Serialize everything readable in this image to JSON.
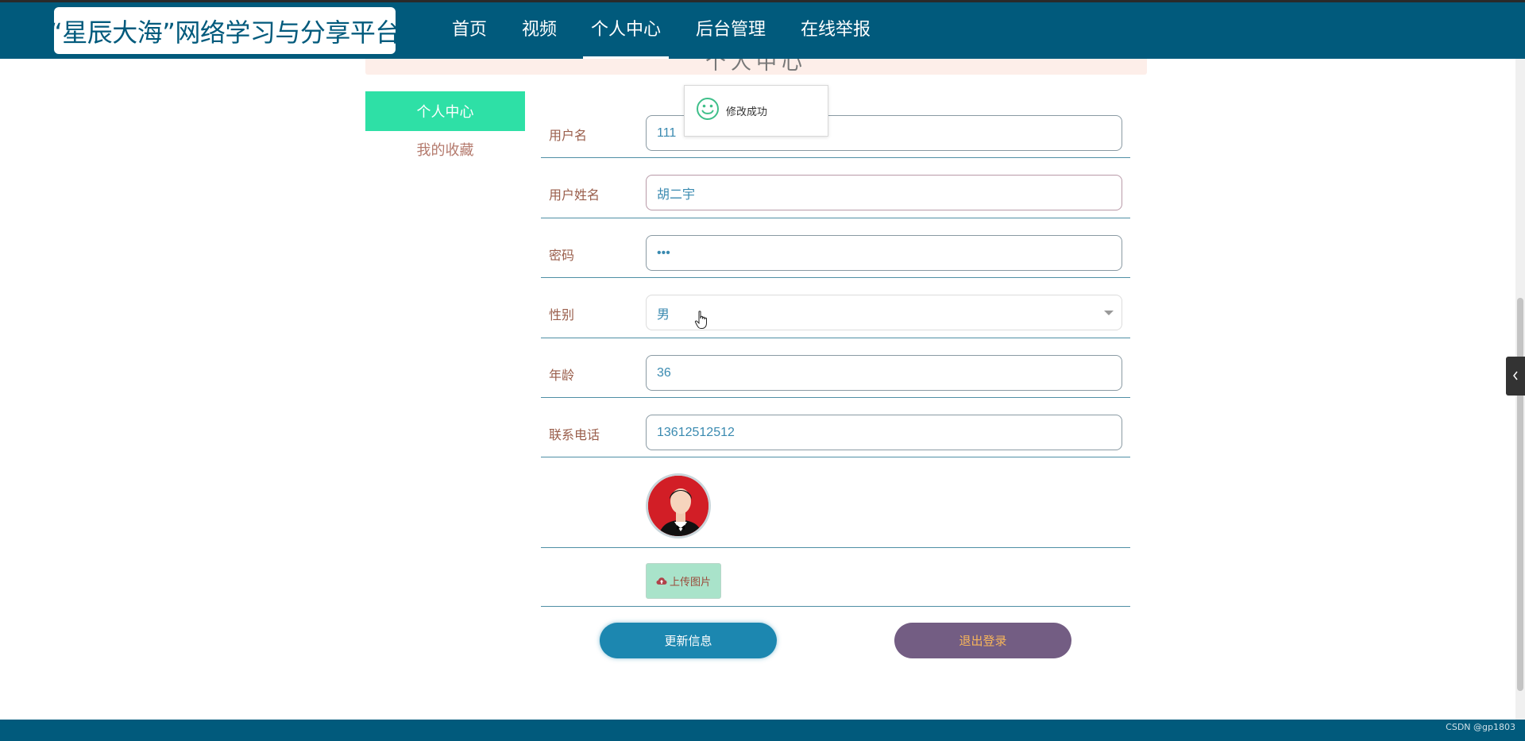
{
  "header": {
    "brand": "“星辰大海”网络学习与分享平台",
    "nav": [
      {
        "label": "首页"
      },
      {
        "label": "视频"
      },
      {
        "label": "个人中心"
      },
      {
        "label": "后台管理"
      },
      {
        "label": "在线举报"
      }
    ],
    "active_index": 2
  },
  "section_title": "个人中心",
  "sidebar": {
    "items": [
      {
        "label": "个人中心",
        "active": true
      },
      {
        "label": "我的收藏",
        "active": false
      }
    ]
  },
  "form": {
    "username": {
      "label": "用户名",
      "value": "111"
    },
    "realname": {
      "label": "用户姓名",
      "value": "胡二宇"
    },
    "password": {
      "label": "密码",
      "value": "•••"
    },
    "gender": {
      "label": "性别",
      "value": "男"
    },
    "age": {
      "label": "年龄",
      "value": "36"
    },
    "phone": {
      "label": "联系电话",
      "value": "13612512512"
    },
    "upload_label": "上传图片"
  },
  "actions": {
    "update": "更新信息",
    "logout": "退出登录"
  },
  "toast": {
    "message": "修改成功",
    "icon": "smile-icon"
  },
  "watermark": "CSDN @gp1803",
  "colors": {
    "navbar": "#015a7c",
    "sidebar_active": "#2ee0a6",
    "update_button": "#1c87b0",
    "logout_button": "#735d83"
  }
}
